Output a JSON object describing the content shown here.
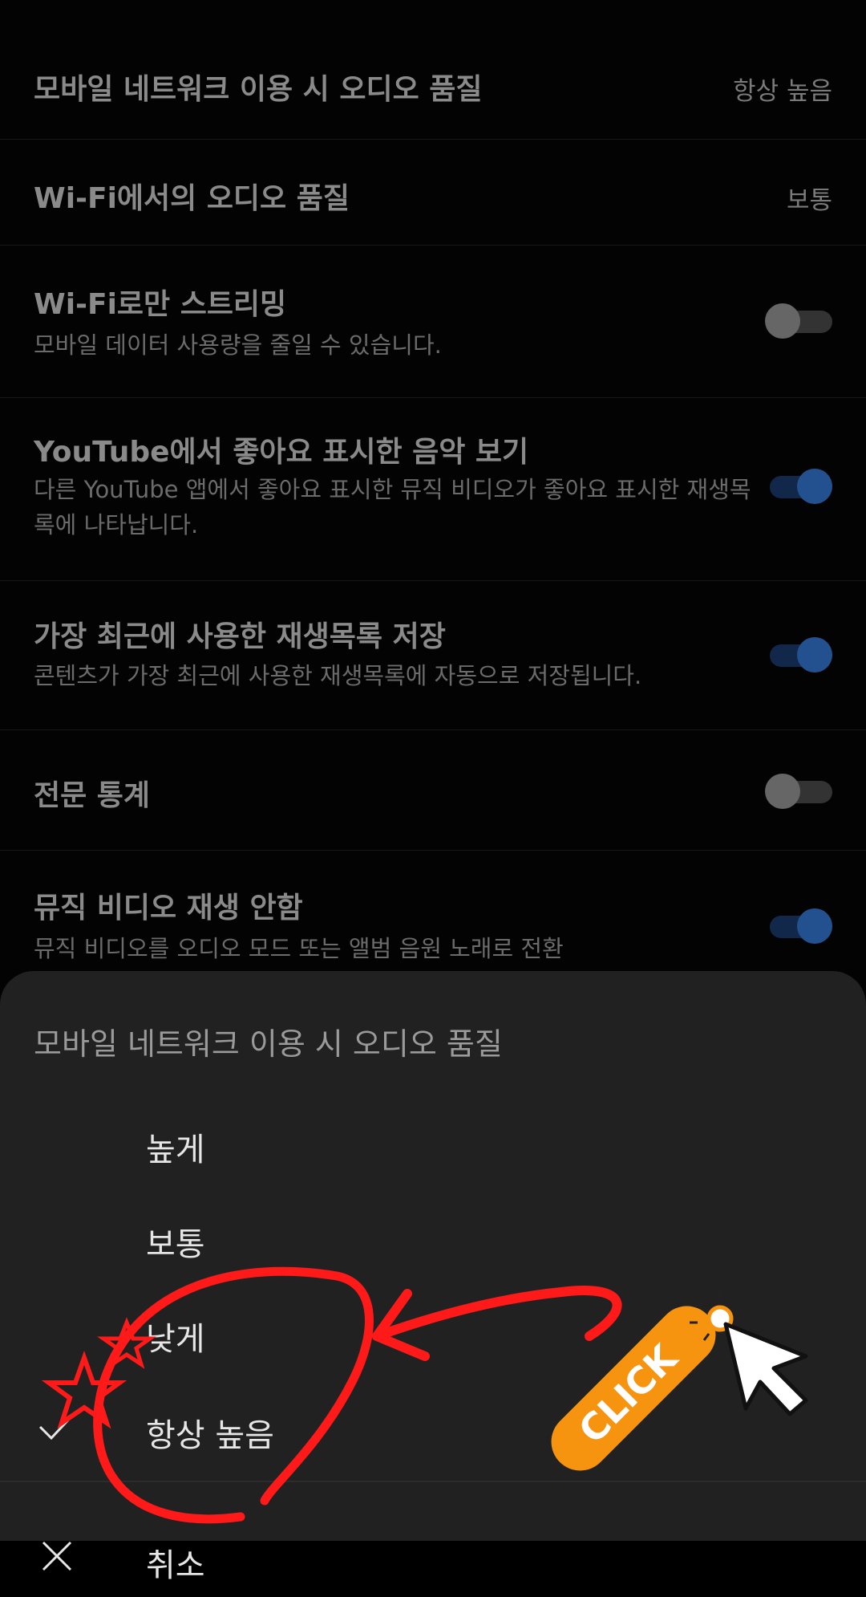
{
  "settings": {
    "mobile_quality": {
      "title": "모바일 네트워크 이용 시 오디오 품질",
      "value": "항상 높음"
    },
    "wifi_quality": {
      "title": "Wi-Fi에서의 오디오 품질",
      "value": "보통"
    },
    "wifi_only": {
      "title": "Wi-Fi로만 스트리밍",
      "sub": "모바일 데이터 사용량을 줄일 수 있습니다.",
      "on": false
    },
    "youtube_likes": {
      "title": "YouTube에서 좋아요 표시한 음악 보기",
      "sub": "다른 YouTube 앱에서 좋아요 표시한 뮤직 비디오가 좋아요 표시한 재생목록에 나타납니다.",
      "on": true
    },
    "save_recent": {
      "title": "가장 최근에 사용한 재생목록 저장",
      "sub": "콘텐츠가 가장 최근에 사용한 재생목록에 자동으로 저장됩니다.",
      "on": true
    },
    "stats": {
      "title": "전문 통계",
      "on": false
    },
    "no_video": {
      "title": "뮤직 비디오 재생 안함",
      "sub": "뮤직 비디오를 오디오 모드 또는 앨범 음원 노래로 전환",
      "on": true
    }
  },
  "sheet": {
    "title": "모바일 네트워크 이용 시 오디오 품질",
    "options": [
      {
        "label": "높게",
        "selected": false
      },
      {
        "label": "보통",
        "selected": false
      },
      {
        "label": "낮게",
        "selected": false
      },
      {
        "label": "항상 높음",
        "selected": true
      }
    ],
    "cancel_label": "취소"
  },
  "annotation": {
    "click_label": "CLICK",
    "accent_color": "#f7940f",
    "mark_color": "#ff1a1a"
  },
  "colors": {
    "background": "#030303",
    "sheet": "#212121",
    "toggle_on": "#23508f"
  }
}
